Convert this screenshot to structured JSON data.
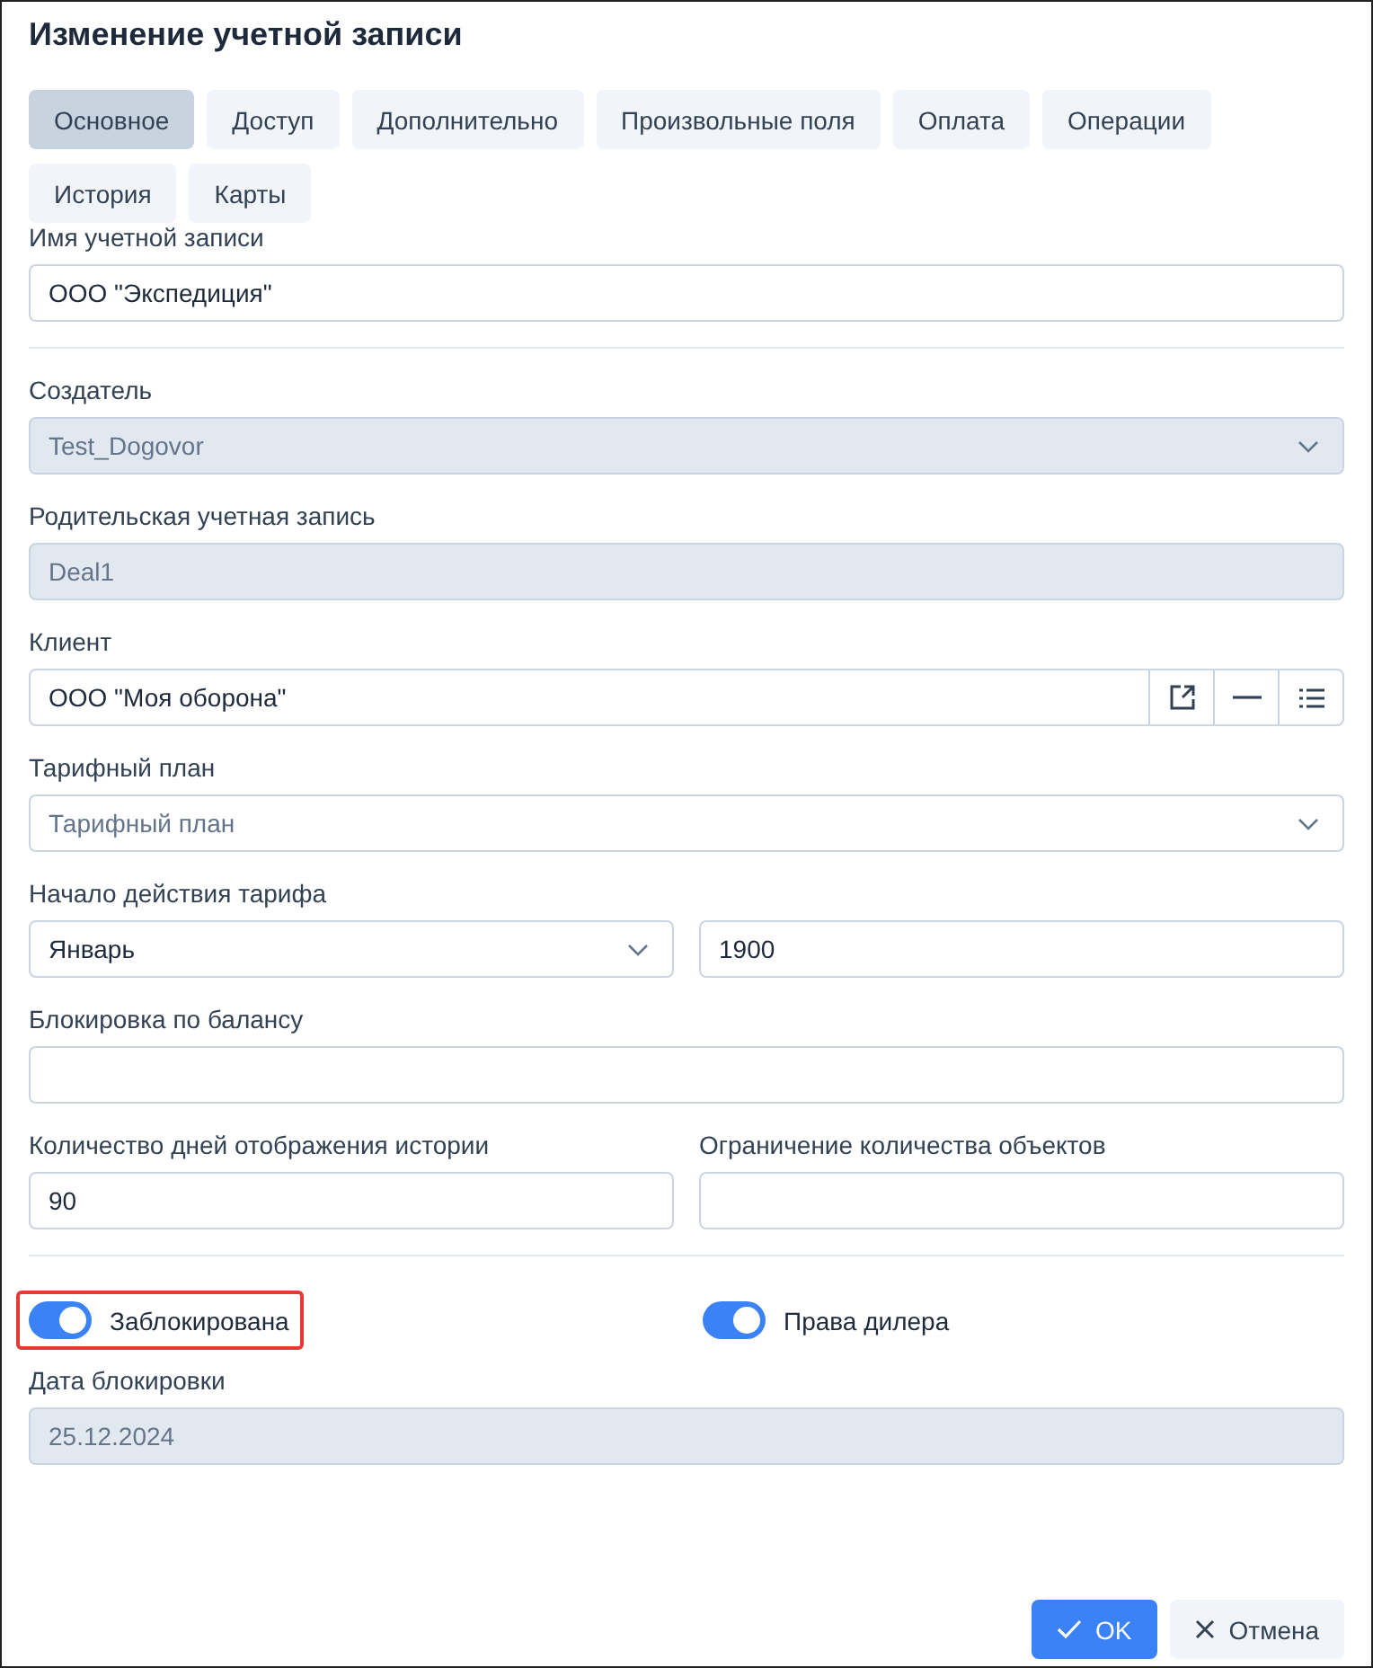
{
  "window": {
    "title": "Изменение учетной записи"
  },
  "tabs": [
    {
      "label": "Основное",
      "selected": true
    },
    {
      "label": "Доступ",
      "selected": false
    },
    {
      "label": "Дополнительно",
      "selected": false
    },
    {
      "label": "Произвольные поля",
      "selected": false
    },
    {
      "label": "Оплата",
      "selected": false
    },
    {
      "label": "Операции",
      "selected": false
    },
    {
      "label": "История",
      "selected": false
    },
    {
      "label": "Карты",
      "selected": false
    }
  ],
  "sections": [
    {
      "rows": [
        [
          {
            "label": "Имя учетной записи",
            "kind": "text",
            "value": "ООО \"Экспедиция\""
          }
        ]
      ]
    },
    {
      "rows": [
        [
          {
            "label": "Создатель",
            "kind": "select",
            "value": "Test_Dogovor",
            "disabled": true
          }
        ],
        [
          {
            "label": "Родительская учетная запись",
            "kind": "text",
            "value": "Deal1",
            "disabled": true
          }
        ],
        [
          {
            "label": "Клиент",
            "kind": "lookup",
            "value": "ООО \"Моя оборона\""
          }
        ],
        [
          {
            "label": "Тарифный план",
            "kind": "select",
            "placeholder": "Тарифный план"
          }
        ],
        [
          {
            "label": "Начало действия тарифа",
            "kind": "select",
            "value": "Январь"
          },
          {
            "kind": "text",
            "value": "1900"
          }
        ],
        [
          {
            "label": "Блокировка по балансу",
            "kind": "text"
          }
        ],
        [
          {
            "label": "Количество дней отображения истории",
            "kind": "text",
            "value": "90"
          },
          {
            "label": "Ограничение количества объектов",
            "kind": "text"
          }
        ]
      ]
    },
    {
      "toggles": [
        {
          "label": "Заблокирована",
          "on": true,
          "highlighted": true
        },
        {
          "label": "Права дилера",
          "on": true
        }
      ],
      "rows": [
        [
          {
            "label": "Дата блокировки",
            "kind": "text",
            "value": "25.12.2024",
            "disabled": true
          }
        ]
      ]
    }
  ],
  "buttons": [
    {
      "label": "OK",
      "kind": "ok"
    },
    {
      "label": "Отмена",
      "kind": "cancel"
    }
  ]
}
